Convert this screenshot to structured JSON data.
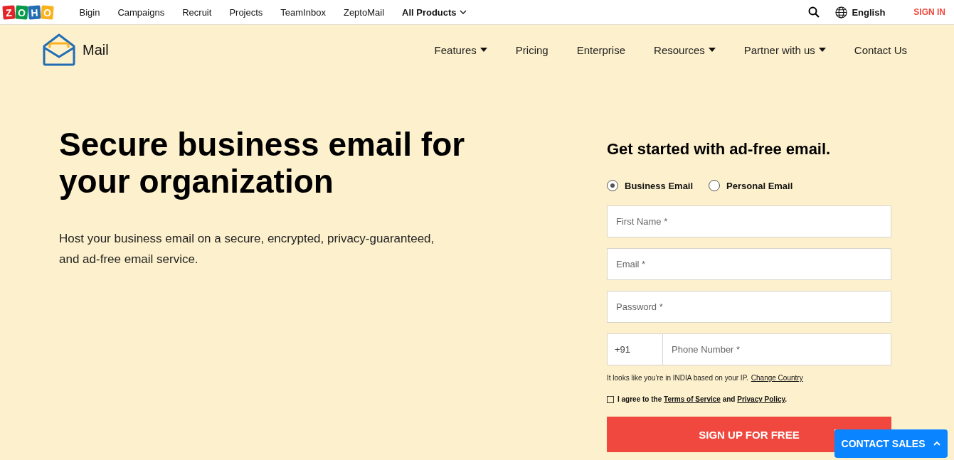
{
  "top_bar": {
    "logo_letters": [
      {
        "letter": "Z",
        "color": "#e42527"
      },
      {
        "letter": "O",
        "color": "#089949"
      },
      {
        "letter": "H",
        "color": "#226db4"
      },
      {
        "letter": "O",
        "color": "#f9b21d"
      }
    ],
    "links": [
      {
        "label": "Bigin",
        "kind": "link"
      },
      {
        "label": "Campaigns",
        "kind": "link"
      },
      {
        "label": "Recruit",
        "kind": "link"
      },
      {
        "label": "Projects",
        "kind": "link"
      },
      {
        "label": "TeamInbox",
        "kind": "link"
      },
      {
        "label": "ZeptoMail",
        "kind": "link"
      },
      {
        "label": "All Products",
        "kind": "dropdown"
      }
    ],
    "language": "English",
    "sign_in": "SIGN IN"
  },
  "product_nav": {
    "brand": "Mail",
    "items": [
      {
        "label": "Features",
        "dropdown": true
      },
      {
        "label": "Pricing",
        "dropdown": false
      },
      {
        "label": "Enterprise",
        "dropdown": false
      },
      {
        "label": "Resources",
        "dropdown": true
      },
      {
        "label": "Partner with us",
        "dropdown": true
      },
      {
        "label": "Contact Us",
        "dropdown": false
      }
    ]
  },
  "hero": {
    "title": "Secure business email for your organization",
    "subtitle": "Host your business email on a secure, encrypted, privacy-guaranteed, and ad-free email service."
  },
  "signup_form": {
    "title": "Get started with ad-free email.",
    "account_types": [
      {
        "label": "Business Email",
        "selected": true
      },
      {
        "label": "Personal Email",
        "selected": false
      }
    ],
    "fields": [
      {
        "placeholder": "First Name *"
      },
      {
        "placeholder": "Email *"
      },
      {
        "placeholder": "Password *"
      }
    ],
    "phone": {
      "code": "+91",
      "placeholder": "Phone Number *"
    },
    "location_note": "It looks like you’re in INDIA based on your IP.",
    "change_country": "Change Country",
    "agreement": {
      "checked": false,
      "parts": [
        {
          "kind": "text",
          "text": "I agree to the "
        },
        {
          "kind": "link",
          "text": "Terms of Service"
        },
        {
          "kind": "text",
          "text": " and "
        },
        {
          "kind": "link",
          "text": "Privacy Policy"
        },
        {
          "kind": "text",
          "text": "."
        }
      ]
    },
    "submit": "SIGN UP FOR FREE"
  },
  "contact_sales": "CONTACT SALES"
}
